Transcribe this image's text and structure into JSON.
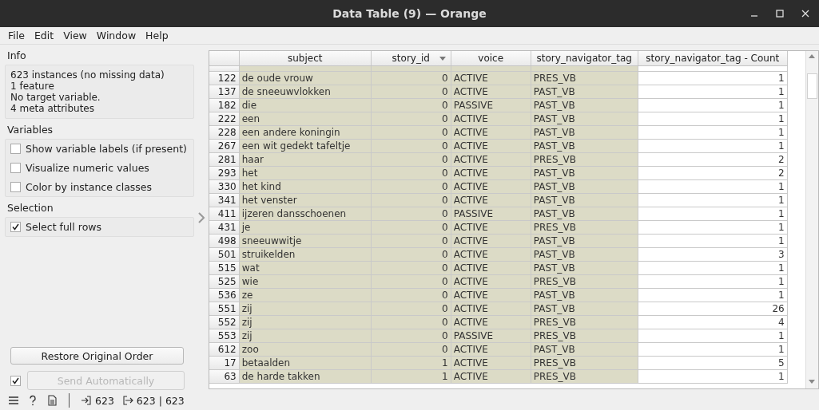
{
  "window": {
    "title": "Data Table (9) — Orange"
  },
  "menu": [
    "File",
    "Edit",
    "View",
    "Window",
    "Help"
  ],
  "info": {
    "title": "Info",
    "lines": [
      "623 instances (no missing data)",
      "1 feature",
      "No target variable.",
      "4 meta attributes"
    ]
  },
  "variables": {
    "title": "Variables",
    "options": [
      {
        "label": "Show variable labels (if present)",
        "checked": false
      },
      {
        "label": "Visualize numeric values",
        "checked": false
      },
      {
        "label": "Color by instance classes",
        "checked": false
      }
    ]
  },
  "selection": {
    "title": "Selection",
    "options": [
      {
        "label": "Select full rows",
        "checked": true
      }
    ]
  },
  "restore_button": "Restore Original Order",
  "send": {
    "label": "Send Automatically",
    "checked": true,
    "disabled": true
  },
  "table": {
    "columns": [
      {
        "label": "subject",
        "sorted": false,
        "kind": "meta"
      },
      {
        "label": "story_id",
        "sorted": true,
        "kind": "meta"
      },
      {
        "label": "voice",
        "sorted": false,
        "kind": "meta"
      },
      {
        "label": "story_navigator_tag",
        "sorted": false,
        "kind": "meta"
      },
      {
        "label": "story_navigator_tag - Count",
        "sorted": false,
        "kind": "feature"
      }
    ],
    "rows": [
      {
        "index": "122",
        "cells": [
          "de oude vrouw",
          "0",
          "ACTIVE",
          "PRES_VB",
          "1"
        ]
      },
      {
        "index": "137",
        "cells": [
          "de sneeuwvlokken",
          "0",
          "ACTIVE",
          "PAST_VB",
          "1"
        ]
      },
      {
        "index": "182",
        "cells": [
          "die",
          "0",
          "PASSIVE",
          "PAST_VB",
          "1"
        ]
      },
      {
        "index": "222",
        "cells": [
          "een",
          "0",
          "ACTIVE",
          "PAST_VB",
          "1"
        ]
      },
      {
        "index": "228",
        "cells": [
          "een andere koningin",
          "0",
          "ACTIVE",
          "PAST_VB",
          "1"
        ]
      },
      {
        "index": "267",
        "cells": [
          "een wit gedekt tafeltje",
          "0",
          "ACTIVE",
          "PAST_VB",
          "1"
        ]
      },
      {
        "index": "281",
        "cells": [
          "haar",
          "0",
          "ACTIVE",
          "PRES_VB",
          "2"
        ]
      },
      {
        "index": "293",
        "cells": [
          "het",
          "0",
          "ACTIVE",
          "PAST_VB",
          "2"
        ]
      },
      {
        "index": "330",
        "cells": [
          "het kind",
          "0",
          "ACTIVE",
          "PAST_VB",
          "1"
        ]
      },
      {
        "index": "341",
        "cells": [
          "het venster",
          "0",
          "ACTIVE",
          "PAST_VB",
          "1"
        ]
      },
      {
        "index": "411",
        "cells": [
          "ijzeren dansschoenen",
          "0",
          "PASSIVE",
          "PAST_VB",
          "1"
        ]
      },
      {
        "index": "431",
        "cells": [
          "je",
          "0",
          "ACTIVE",
          "PRES_VB",
          "1"
        ]
      },
      {
        "index": "498",
        "cells": [
          "sneeuwwitje",
          "0",
          "ACTIVE",
          "PAST_VB",
          "1"
        ]
      },
      {
        "index": "501",
        "cells": [
          "struikelden",
          "0",
          "ACTIVE",
          "PAST_VB",
          "3"
        ]
      },
      {
        "index": "515",
        "cells": [
          "wat",
          "0",
          "ACTIVE",
          "PAST_VB",
          "1"
        ]
      },
      {
        "index": "525",
        "cells": [
          "wie",
          "0",
          "ACTIVE",
          "PRES_VB",
          "1"
        ]
      },
      {
        "index": "536",
        "cells": [
          "ze",
          "0",
          "ACTIVE",
          "PAST_VB",
          "1"
        ]
      },
      {
        "index": "551",
        "cells": [
          "zij",
          "0",
          "ACTIVE",
          "PAST_VB",
          "26"
        ]
      },
      {
        "index": "552",
        "cells": [
          "zij",
          "0",
          "ACTIVE",
          "PRES_VB",
          "4"
        ]
      },
      {
        "index": "553",
        "cells": [
          "zij",
          "0",
          "PASSIVE",
          "PRES_VB",
          "1"
        ]
      },
      {
        "index": "612",
        "cells": [
          "zoo",
          "0",
          "ACTIVE",
          "PAST_VB",
          "1"
        ]
      },
      {
        "index": "17",
        "cells": [
          "betaalden",
          "1",
          "ACTIVE",
          "PRES_VB",
          "5"
        ]
      },
      {
        "index": "63",
        "cells": [
          "de harde takken",
          "1",
          "ACTIVE",
          "PRES_VB",
          "1"
        ]
      }
    ]
  },
  "status_bar": {
    "input_count": "623",
    "output_count": "623 | 623"
  }
}
